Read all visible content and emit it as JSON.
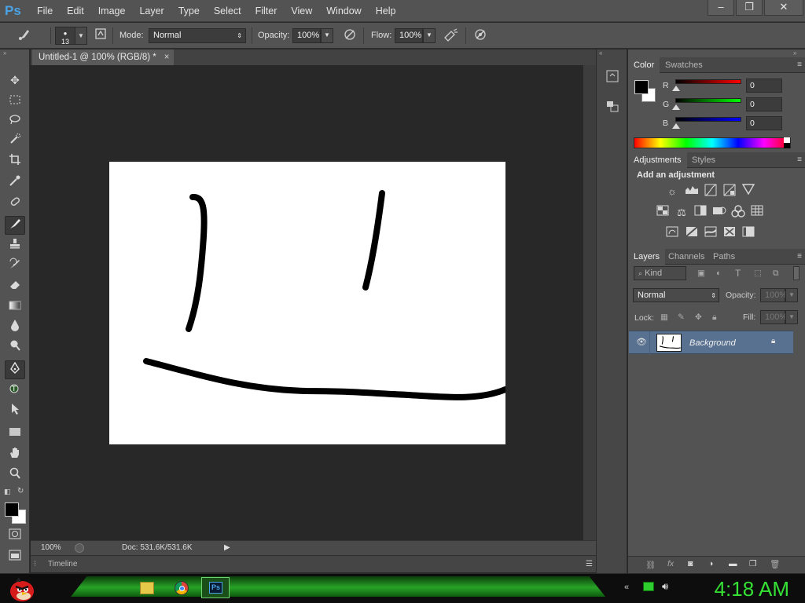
{
  "app": {
    "logo": "Ps"
  },
  "menubar": {
    "items": [
      "File",
      "Edit",
      "Image",
      "Layer",
      "Type",
      "Select",
      "Filter",
      "View",
      "Window",
      "Help"
    ],
    "window_buttons": [
      "–",
      "❐",
      "✕"
    ]
  },
  "options_bar": {
    "brush_size": "13",
    "mode_label": "Mode:",
    "mode_value": "Normal",
    "opacity_label": "Opacity:",
    "opacity_value": "100%",
    "flow_label": "Flow:",
    "flow_value": "100%"
  },
  "document": {
    "tab_title": "Untitled-1 @ 100% (RGB/8) *",
    "tab_close": "×",
    "zoom": "100%",
    "doc_info": "Doc: 531.6K/531.6K",
    "timeline_label": "Timeline"
  },
  "tools": {
    "icons": [
      "move-icon",
      "marquee-icon",
      "lasso-icon",
      "quick-select-icon",
      "crop-icon",
      "eyedropper-icon",
      "healing-brush-icon",
      "brush-icon",
      "stamp-icon",
      "history-brush-icon",
      "eraser-icon",
      "gradient-icon",
      "blur-icon",
      "dodge-icon",
      "pen-icon",
      "type-icon",
      "path-select-icon",
      "rectangle-icon",
      "hand-icon",
      "zoom-icon"
    ],
    "active": "brush-icon",
    "foreground_color": "#000000",
    "background_color": "#ffffff"
  },
  "color_panel": {
    "tabs": [
      "Color",
      "Swatches"
    ],
    "active_tab": "Color",
    "channels": [
      {
        "label": "R",
        "value": "0",
        "color": "#e02020"
      },
      {
        "label": "G",
        "value": "0",
        "color": "#20c020"
      },
      {
        "label": "B",
        "value": "0",
        "color": "#2020e0"
      }
    ]
  },
  "adjustments_panel": {
    "tabs": [
      "Adjustments",
      "Styles"
    ],
    "active_tab": "Adjustments",
    "heading": "Add an adjustment"
  },
  "layers_panel": {
    "tabs": [
      "Layers",
      "Channels",
      "Paths"
    ],
    "active_tab": "Layers",
    "filter_kind": "Kind",
    "blend_mode": "Normal",
    "opacity_label": "Opacity:",
    "opacity_value": "100%",
    "lock_label": "Lock:",
    "fill_label": "Fill:",
    "fill_value": "100%",
    "layers": [
      {
        "name": "Background",
        "visible": true,
        "locked": true
      }
    ]
  },
  "taskbar": {
    "clock": "4:18 AM"
  }
}
